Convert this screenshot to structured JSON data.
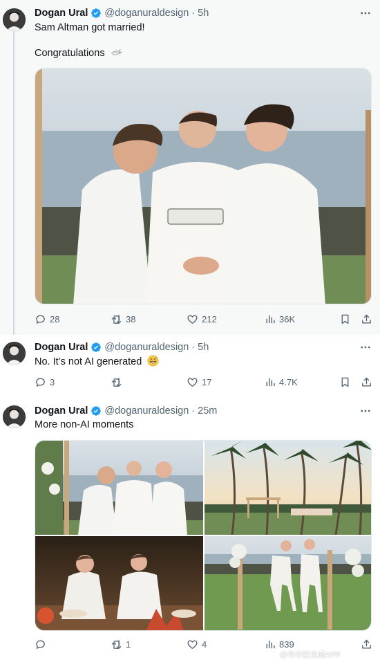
{
  "colors": {
    "verified": "#1d9bf0",
    "muted": "#536471",
    "text": "#0f1419",
    "thread_line": "#cfd9de"
  },
  "tweets": [
    {
      "name": "Dogan Ural",
      "handle": "@doganuraldesign",
      "dot": "·",
      "time": "5h",
      "line1": "Sam Altman got married!",
      "line2": "Congratulations",
      "emoji": "dove",
      "replies": "28",
      "retweets": "38",
      "likes": "212",
      "views": "36K"
    },
    {
      "name": "Dogan Ural",
      "handle": "@doganuraldesign",
      "dot": "·",
      "time": "5h",
      "line1": "No. It’s not AI generated",
      "emoji": "grinning-sweat-face",
      "replies": "3",
      "retweets": "",
      "likes": "17",
      "views": "4.7K"
    },
    {
      "name": "Dogan Ural",
      "handle": "@doganuraldesign",
      "dot": "·",
      "time": "25m",
      "line1": "More non-AI moments",
      "replies": "",
      "retweets": "1",
      "likes": "4",
      "views": "839"
    }
  ],
  "icons": [
    "verified-badge-icon",
    "more-icon",
    "reply-icon",
    "retweet-icon",
    "like-icon",
    "views-icon",
    "bookmark-icon",
    "share-icon"
  ],
  "watermark": "@华尔街见闻APP"
}
